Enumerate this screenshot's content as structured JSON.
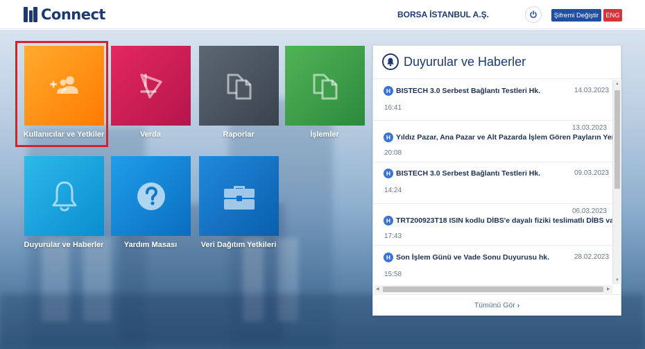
{
  "header": {
    "logo_text": "Connect",
    "company_name": "BORSA İSTANBUL A.Ş.",
    "change_password_label": "Şifremi Değiştir",
    "language_label": "ENG"
  },
  "tiles": [
    {
      "label": "Kullanıcılar ve Yetkiler",
      "icon": "add-users-icon",
      "color_from": "#ffa726",
      "color_to": "#ff7a00"
    },
    {
      "label": "Verda",
      "icon": "verda-triangle-icon",
      "color_from": "#e0245e",
      "color_to": "#b8174e"
    },
    {
      "label": "Raporlar",
      "icon": "documents-icon",
      "color_from": "#5b6570",
      "color_to": "#3c454f"
    },
    {
      "label": "İşlemler",
      "icon": "documents-icon",
      "color_from": "#4caf50",
      "color_to": "#2e8b3e"
    },
    {
      "label": "Duyurular ve Haberler",
      "icon": "bell-icon",
      "color_from": "#29b6e8",
      "color_to": "#0a8fd0"
    },
    {
      "label": "Yardım Masası",
      "icon": "help-icon",
      "color_from": "#1e9be6",
      "color_to": "#0b6fc2"
    },
    {
      "label": "Veri Dağıtım Yetkileri",
      "icon": "briefcase-icon",
      "color_from": "#1e88d8",
      "color_to": "#0b5fb0"
    }
  ],
  "news": {
    "title": "Duyurular ve Haberler",
    "see_all_label": "Tümünü Gör",
    "items": [
      {
        "badge": "H",
        "text": "BISTECH 3.0 Serbest Bağlantı Testleri Hk.",
        "date": "14.03.2023",
        "time": "16:41"
      },
      {
        "badge": "H",
        "text": "Yıldız Pazar, Ana Pazar ve Alt Pazarda İşlem Gören Payların Yen...",
        "date": "13.03.2023",
        "time": "20:08"
      },
      {
        "badge": "H",
        "text": "BISTECH 3.0 Serbest Bağlantı Testleri Hk.",
        "date": "09.03.2023",
        "time": "14:24"
      },
      {
        "badge": "H",
        "text": "TRT200923T18 ISIN kodlu DİBS'e dayalı fiziki teslimatlı DİBS va...",
        "date": "06.03.2023",
        "time": "17:43"
      },
      {
        "badge": "H",
        "text": "Son İşlem Günü ve Vade Sonu Duyurusu hk.",
        "date": "28.02.2023",
        "time": "15:58"
      }
    ]
  },
  "colors": {
    "brand_navy": "#1c3a70",
    "button_blue": "#1f4fa3",
    "eng_red": "#d6343c",
    "highlight_red": "#d0232e",
    "badge_blue": "#3a73d6"
  }
}
